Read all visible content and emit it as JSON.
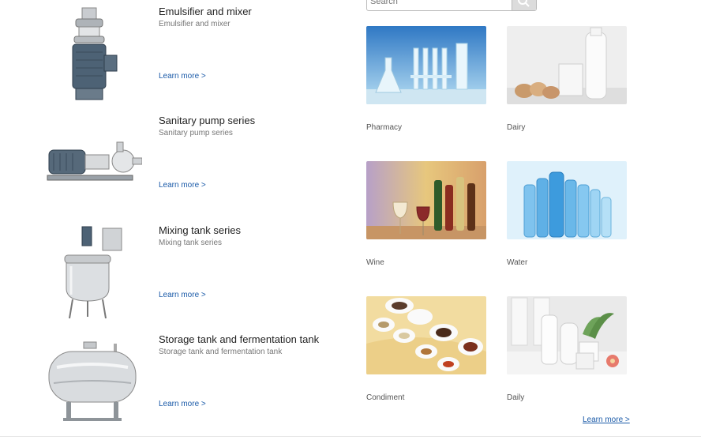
{
  "search": {
    "placeholder": "Search"
  },
  "products": [
    {
      "title": "Emulsifier and mixer",
      "subtitle": "Emulsifier and mixer",
      "link": "Learn more >"
    },
    {
      "title": "Sanitary pump series",
      "subtitle": "Sanitary pump series",
      "link": "Learn more >"
    },
    {
      "title": "Mixing tank series",
      "subtitle": "Mixing tank series",
      "link": "Learn more >"
    },
    {
      "title": "Storage tank and fermentation tank",
      "subtitle": "Storage tank and fermentation tank",
      "link": "Learn more >"
    }
  ],
  "categories": [
    {
      "label": "Pharmacy"
    },
    {
      "label": "Dairy"
    },
    {
      "label": "Wine"
    },
    {
      "label": "Water"
    },
    {
      "label": "Condiment"
    },
    {
      "label": "Daily"
    }
  ],
  "more_link": "Learn more >",
  "colors": {
    "link": "#1a5aa8",
    "title": "#222222",
    "subtitle": "#777777"
  }
}
